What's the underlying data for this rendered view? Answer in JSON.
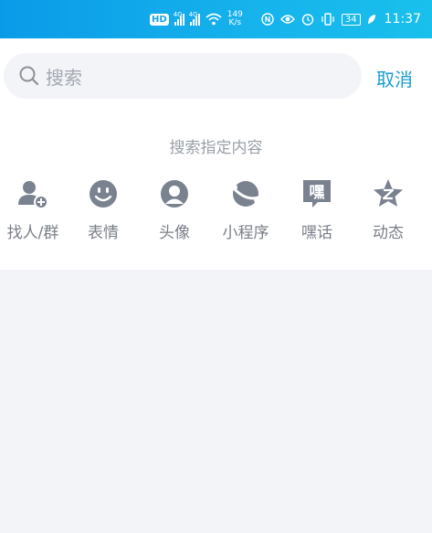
{
  "status_bar": {
    "hd": "HD",
    "net1": "4G",
    "net2": "4G",
    "speed_value": "149",
    "speed_unit": "K/s",
    "battery": "34",
    "time": "11:37"
  },
  "search": {
    "placeholder": "搜索",
    "cancel_label": "取消"
  },
  "section": {
    "title": "搜索指定内容"
  },
  "categories": [
    {
      "label": "找人/群",
      "icon": "find-people-icon"
    },
    {
      "label": "表情",
      "icon": "emoji-icon"
    },
    {
      "label": "头像",
      "icon": "avatar-icon"
    },
    {
      "label": "小程序",
      "icon": "mini-program-icon"
    },
    {
      "label": "嘿话",
      "icon": "heihua-icon"
    },
    {
      "label": "动态",
      "icon": "dynamic-icon"
    }
  ],
  "colors": {
    "accent": "#1c9ecf",
    "icon": "#7a8290",
    "status_bar": "#14a6ea"
  }
}
